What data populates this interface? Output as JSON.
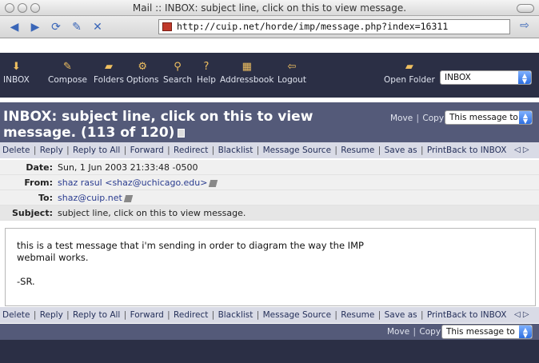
{
  "window": {
    "title": "Mail :: INBOX: subject line, click on this to view message."
  },
  "browser": {
    "url": "http://cuip.net/horde/imp/message.php?index=16311"
  },
  "menu": {
    "items": [
      {
        "label": "INBOX",
        "icon": "inbox-icon"
      },
      {
        "label": "Compose",
        "icon": "compose-icon"
      },
      {
        "label": "Folders",
        "icon": "folders-icon"
      },
      {
        "label": "Options",
        "icon": "options-icon"
      },
      {
        "label": "Search",
        "icon": "search-icon"
      },
      {
        "label": "Help",
        "icon": "help-icon"
      },
      {
        "label": "Addressbook",
        "icon": "addressbook-icon"
      },
      {
        "label": "Logout",
        "icon": "logout-icon"
      }
    ],
    "open_folder_label": "Open Folder",
    "folder_select_value": "INBOX"
  },
  "header": {
    "title": "INBOX: subject line, click on this to view message. (113 of 120)",
    "move_label": "Move",
    "copy_label": "Copy",
    "target_select_value": "This message to"
  },
  "actions": [
    "Delete",
    "Reply",
    "Reply to All",
    "Forward",
    "Redirect",
    "Blacklist",
    "Message Source",
    "Resume",
    "Save as",
    "Print"
  ],
  "back_label": "Back to INBOX",
  "nav_arrows": "◁ ▷",
  "message": {
    "date_label": "Date:",
    "date": "Sun, 1 Jun 2003 21:33:48 -0500",
    "from_label": "From:",
    "from": "shaz rasul <shaz@uchicago.edu>",
    "to_label": "To:",
    "to": "shaz@cuip.net",
    "subject_label": "Subject:",
    "subject": "subject line, click on this to view message.",
    "body_paragraph": "this is a test message that i'm sending in order to diagram the way the IMP\nwebmail works.",
    "signature": "-SR."
  },
  "footer": {
    "move_label": "Move",
    "copy_label": "Copy",
    "target_select_value": "This message to"
  },
  "colors": {
    "menu_bg": "#2b2f45",
    "header_bg": "#545a79",
    "action_row_bg": "#d9dbe6"
  }
}
